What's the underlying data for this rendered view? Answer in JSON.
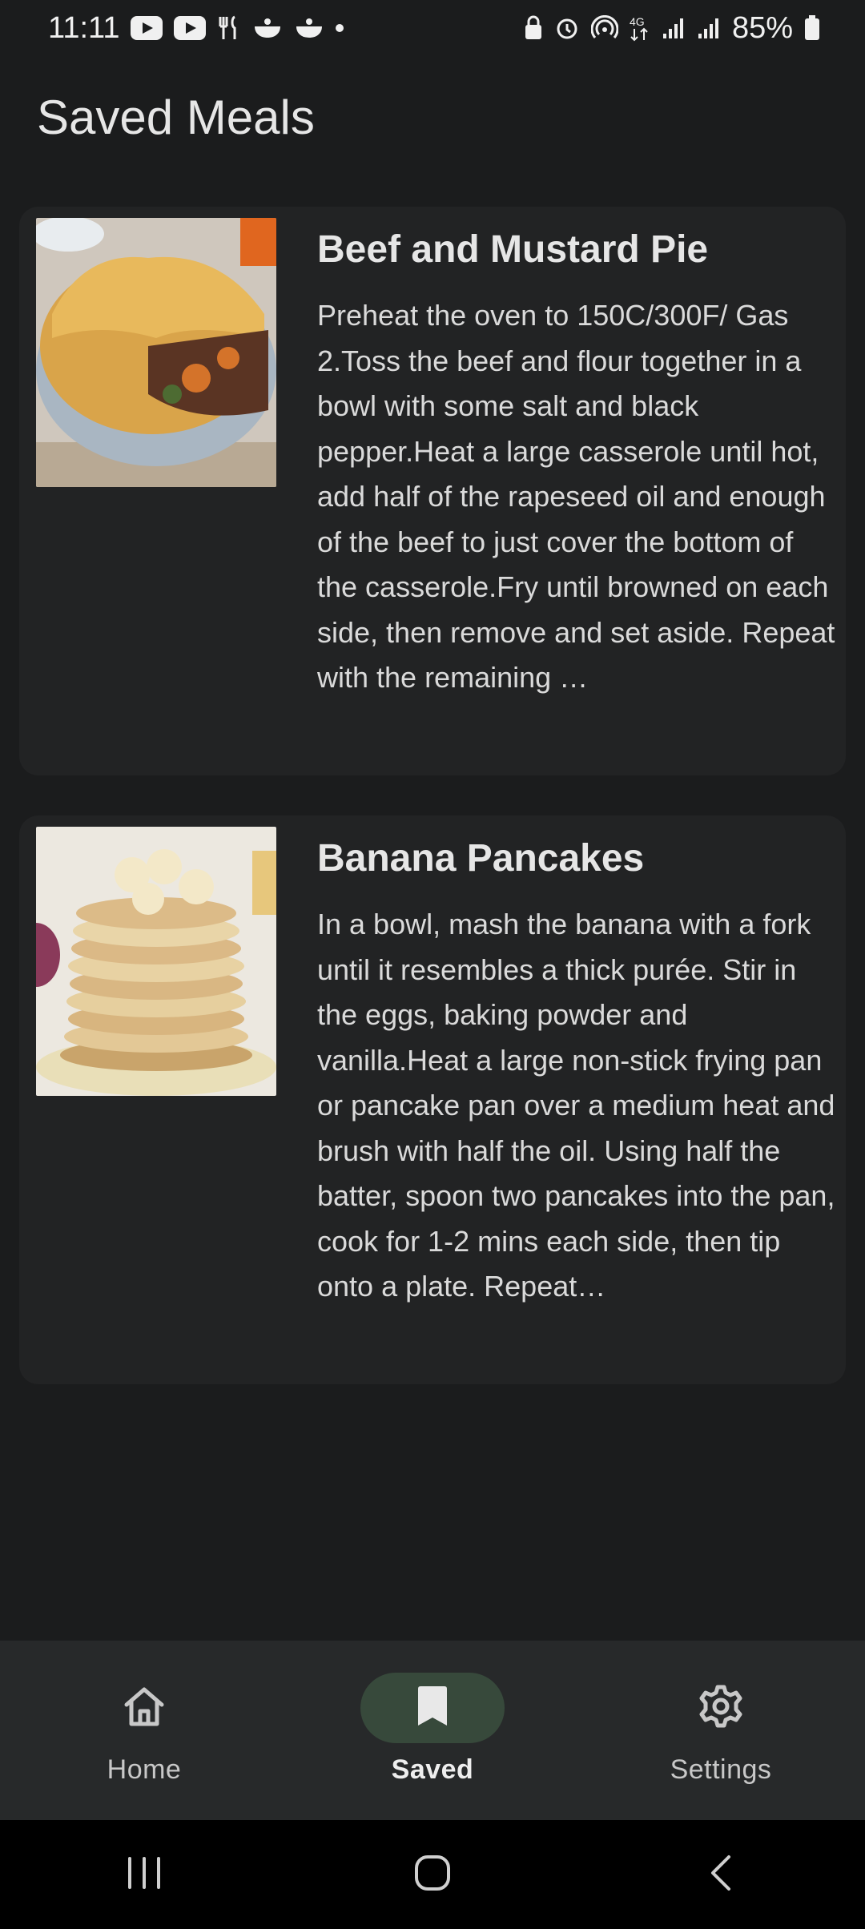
{
  "status_bar": {
    "time": "11:11",
    "battery": "85%"
  },
  "page": {
    "title": "Saved Meals"
  },
  "meals": [
    {
      "title": "Beef and Mustard Pie",
      "description": "Preheat the oven to 150C/300F/ Gas 2.Toss the beef and flour together in a bowl with some salt and black pepper.Heat a large casserole until hot, add half of the rapeseed oil and enough of the beef to just cover the bottom of the casserole.Fry until browned on each side, then remove and set aside. Repeat with the remaining …"
    },
    {
      "title": "Banana Pancakes",
      "description": "In a bowl, mash the banana with a fork until it resembles a thick purée. Stir in the eggs, baking powder and vanilla.Heat a large non-stick frying pan or pancake pan over a medium heat and brush with half the oil. Using half the batter, spoon two pancakes into the pan, cook for 1-2 mins each side, then tip onto a plate. Repeat…"
    }
  ],
  "bottom_nav": {
    "items": [
      {
        "label": "Home",
        "icon": "home-icon",
        "active": false
      },
      {
        "label": "Saved",
        "icon": "bookmark-icon",
        "active": true
      },
      {
        "label": "Settings",
        "icon": "gear-icon",
        "active": false
      }
    ]
  },
  "colors": {
    "background": "#1b1c1d",
    "card": "#222324",
    "nav_bar": "#27292a",
    "nav_active_pill": "#37493b"
  }
}
